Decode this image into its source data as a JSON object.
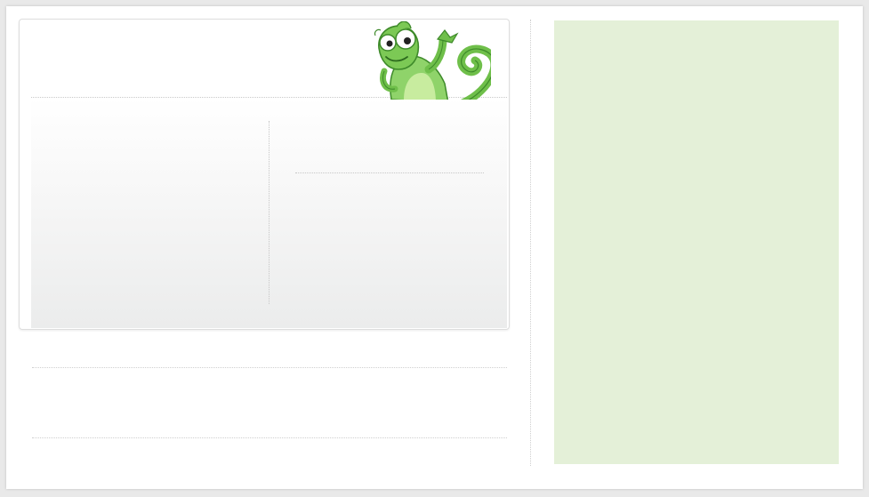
{
  "colors": {
    "page_background": "#e9e9e9",
    "frame_background": "#ffffff",
    "side_panel": "#e4f0d8",
    "mascot_green": "#6fbf4a",
    "mascot_dark_green": "#3e8a2a",
    "divider": "#cfcfcf"
  },
  "mascot": {
    "icon": "chameleon-icon"
  }
}
